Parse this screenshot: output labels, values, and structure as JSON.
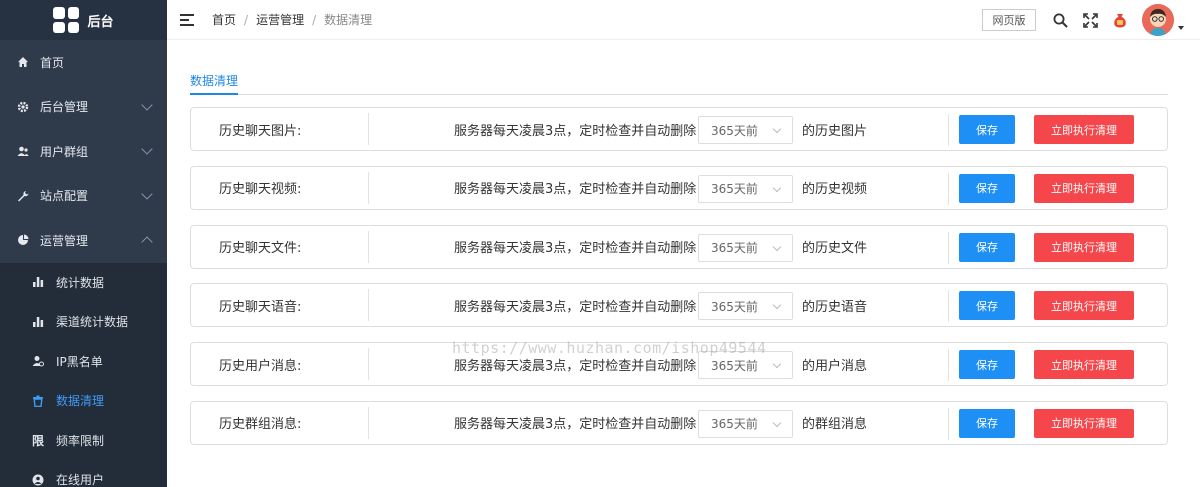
{
  "app": {
    "logo_text": "后台"
  },
  "sidebar": {
    "items": [
      {
        "label": "首页",
        "icon": "home-icon"
      },
      {
        "label": "后台管理",
        "icon": "gear-icon"
      },
      {
        "label": "用户群组",
        "icon": "users-icon"
      },
      {
        "label": "站点配置",
        "icon": "wrench-icon"
      },
      {
        "label": "运营管理",
        "icon": "operations-icon"
      }
    ],
    "subitems": [
      {
        "label": "统计数据",
        "icon": "bar-chart-icon"
      },
      {
        "label": "渠道统计数据",
        "icon": "bar-chart-icon"
      },
      {
        "label": "IP黑名单",
        "icon": "user-block-icon"
      },
      {
        "label": "数据清理",
        "icon": "trash-icon",
        "active": true
      },
      {
        "label": "频率限制",
        "icon": "limit-glyph",
        "glyph": "限"
      },
      {
        "label": "在线用户",
        "icon": "online-user-icon"
      }
    ]
  },
  "header": {
    "breadcrumb": [
      "首页",
      "运营管理",
      "数据清理"
    ],
    "separator": "/",
    "web_version_label": "网页版"
  },
  "main": {
    "tab_label": "数据清理",
    "desc_text": "服务器每天凌晨3点，定时检查并自动删除",
    "save_label": "保存",
    "clean_label": "立即执行清理",
    "rows": [
      {
        "label": "历史聊天图片:",
        "value": "365天前",
        "suffix": "的历史图片"
      },
      {
        "label": "历史聊天视频:",
        "value": "365天前",
        "suffix": "的历史视频"
      },
      {
        "label": "历史聊天文件:",
        "value": "365天前",
        "suffix": "的历史文件"
      },
      {
        "label": "历史聊天语音:",
        "value": "365天前",
        "suffix": "的历史语音"
      },
      {
        "label": "历史用户消息:",
        "value": "365天前",
        "suffix": "的用户消息"
      },
      {
        "label": "历史群组消息:",
        "value": "365天前",
        "suffix": "的群组消息"
      }
    ]
  },
  "watermark": "https://www.huzhan.com/ishop49544",
  "colors": {
    "sidebar_bg": "#2f3a4b",
    "accent": "#1e8ff5",
    "danger": "#f5474b"
  }
}
